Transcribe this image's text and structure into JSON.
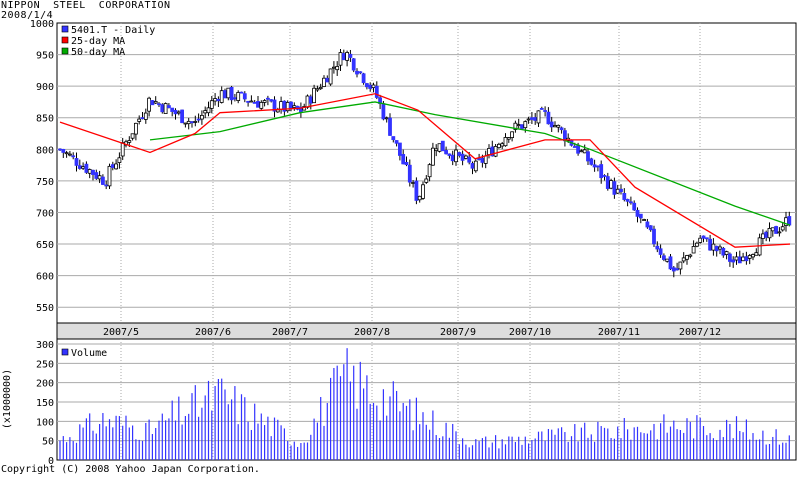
{
  "header": {
    "company": "NIPPON  STEEL  CORPORATION",
    "date": "2008/1/4"
  },
  "footer": {
    "copyright": "Copyright (C) 2008 Yahoo Japan Corporation."
  },
  "colors": {
    "candle_up": "#ffffff",
    "candle_down": "#3333ff",
    "ma25": "#ff0000",
    "ma50": "#00aa00",
    "volume_bar": "#3333ff",
    "grid": "#aaaaaa",
    "date_band": "#dddddd"
  },
  "chart_data": [
    {
      "type": "candlestick",
      "legend": [
        "5401.T - Daily",
        "25-day MA",
        "50-day MA"
      ],
      "legend_placement": "top-left",
      "yticks": [
        1000,
        950,
        900,
        850,
        800,
        750,
        700,
        650,
        600,
        550
      ],
      "ylim": [
        525,
        1000
      ],
      "month_labels": [
        "2007/5",
        "2007/6",
        "2007/7",
        "2007/8",
        "2007/9",
        "2007/10",
        "2007/11",
        "2007/12"
      ],
      "grid": true,
      "ohlc_checkpoints": [
        {
          "approx_date": "2007/4 late",
          "close": 800
        },
        {
          "approx_date": "2007/5 early",
          "close": 750
        },
        {
          "approx_date": "2007/5 mid",
          "close": 880
        },
        {
          "approx_date": "2007/6 start",
          "close": 840
        },
        {
          "approx_date": "2007/6 mid",
          "close": 890
        },
        {
          "approx_date": "2007/7 start",
          "close": 870
        },
        {
          "approx_date": "2007/7 mid",
          "close": 860
        },
        {
          "approx_date": "2007/7 late",
          "close": 955
        },
        {
          "approx_date": "2007/8 start",
          "close": 890
        },
        {
          "approx_date": "2007/8 mid",
          "close": 720
        },
        {
          "approx_date": "2007/9 start",
          "close": 810
        },
        {
          "approx_date": "2007/9 mid",
          "close": 770
        },
        {
          "approx_date": "2007/10 start",
          "close": 830
        },
        {
          "approx_date": "2007/10 mid",
          "close": 855
        },
        {
          "approx_date": "2007/11 start",
          "close": 780
        },
        {
          "approx_date": "2007/11 mid",
          "close": 700
        },
        {
          "approx_date": "2007/11 late",
          "close": 605
        },
        {
          "approx_date": "2007/12 start",
          "close": 660
        },
        {
          "approx_date": "2007/12 mid",
          "close": 620
        },
        {
          "approx_date": "2008/1 start",
          "close": 690
        }
      ],
      "ma25_points": [
        {
          "approx_date": "2007/4 late",
          "value": 843
        },
        {
          "approx_date": "2007/5 mid",
          "value": 795
        },
        {
          "approx_date": "2007/6 start",
          "value": 825
        },
        {
          "approx_date": "2007/6 mid",
          "value": 858
        },
        {
          "approx_date": "2007/7 mid",
          "value": 865
        },
        {
          "approx_date": "2007/8 start",
          "value": 888
        },
        {
          "approx_date": "2007/8 mid",
          "value": 862
        },
        {
          "approx_date": "2007/9 mid",
          "value": 785
        },
        {
          "approx_date": "2007/10 mid",
          "value": 815
        },
        {
          "approx_date": "2007/11 start",
          "value": 815
        },
        {
          "approx_date": "2007/11 mid",
          "value": 740
        },
        {
          "approx_date": "2007/12 mid",
          "value": 645
        },
        {
          "approx_date": "2008/1 start",
          "value": 650
        }
      ],
      "ma50_points": [
        {
          "approx_date": "2007/5 mid",
          "value": 815
        },
        {
          "approx_date": "2007/6 mid",
          "value": 828
        },
        {
          "approx_date": "2007/7 mid",
          "value": 858
        },
        {
          "approx_date": "2007/8 start",
          "value": 875
        },
        {
          "approx_date": "2007/9 start",
          "value": 855
        },
        {
          "approx_date": "2007/10 mid",
          "value": 825
        },
        {
          "approx_date": "2007/11 start",
          "value": 800
        },
        {
          "approx_date": "2007/12 mid",
          "value": 710
        },
        {
          "approx_date": "2008/1 start",
          "value": 680
        }
      ]
    },
    {
      "type": "bar",
      "legend": [
        "Volume"
      ],
      "ylabel": "(x1000000)",
      "yticks": [
        300,
        250,
        200,
        150,
        100,
        50,
        0
      ],
      "ylim": [
        0,
        300
      ],
      "grid": true,
      "volume_checkpoints": [
        {
          "approx_date": "2007/4 late",
          "value": 70
        },
        {
          "approx_date": "2007/5 early",
          "value": 140
        },
        {
          "approx_date": "2007/5 mid",
          "value": 100
        },
        {
          "approx_date": "2007/5 late",
          "value": 155
        },
        {
          "approx_date": "2007/6 mid",
          "value": 225
        },
        {
          "approx_date": "2007/7 mid",
          "value": 60
        },
        {
          "approx_date": "2007/7 late",
          "value": 290
        },
        {
          "approx_date": "2007/8 mid",
          "value": 155
        },
        {
          "approx_date": "2007/9 mid",
          "value": 60
        },
        {
          "approx_date": "2007/10 mid",
          "value": 80
        },
        {
          "approx_date": "2007/11 late",
          "value": 120
        },
        {
          "approx_date": "2007/12 mid",
          "value": 110
        },
        {
          "approx_date": "2008/1 start",
          "value": 70
        }
      ]
    }
  ]
}
